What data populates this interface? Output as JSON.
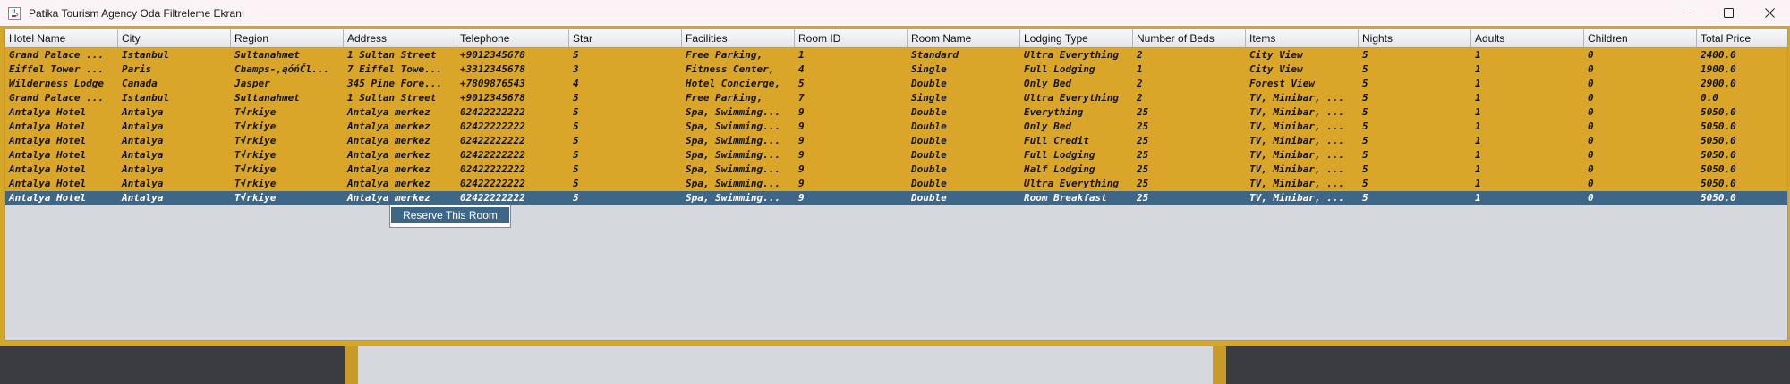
{
  "window": {
    "title": "Patika Tourism Agency Oda Filtreleme Ekranı",
    "icons": {
      "app": "java-cup-icon",
      "minimize": "minimize-icon",
      "maximize": "maximize-icon",
      "close": "close-icon"
    }
  },
  "table": {
    "columns": [
      "Hotel Name",
      "City",
      "Region",
      "Address",
      "Telephone",
      "Star",
      "Facilities",
      "Room ID",
      "Room Name",
      "Lodging Type",
      "Number of Beds",
      "Items",
      "Nights",
      "Adults",
      "Children",
      "Total Price"
    ],
    "rows": [
      [
        "Grand Palace ...",
        "Istanbul",
        "Sultanahmet",
        "1 Sultan Street",
        "+9012345678",
        "5",
        "Free Parking,",
        "1",
        "Standard",
        "Ultra Everything",
        "2",
        "City View",
        "5",
        "1",
        "0",
        "2400.0"
      ],
      [
        "Eiffel Tower ...",
        "Paris",
        "Champs-,ąóńČl...",
        "7 Eiffel Towe...",
        "+3312345678",
        "3",
        "Fitness Center,",
        "4",
        "Single",
        "Full Lodging",
        "1",
        "City View",
        "5",
        "1",
        "0",
        "1900.0"
      ],
      [
        "Wilderness Lodge",
        "Canada",
        "Jasper",
        "345 Pine Fore...",
        "+7809876543",
        "4",
        "Hotel Concierge,",
        "5",
        "Double",
        "Only Bed",
        "2",
        "Forest View",
        "5",
        "1",
        "0",
        "2900.0"
      ],
      [
        "Grand Palace ...",
        "Istanbul",
        "Sultanahmet",
        "1 Sultan Street",
        "+9012345678",
        "5",
        "Free Parking,",
        "7",
        "Single",
        "Ultra Everything",
        "2",
        "TV, Minibar, ...",
        "5",
        "1",
        "0",
        "0.0"
      ],
      [
        "Antalya Hotel",
        "Antalya",
        "T√rkiye",
        "Antalya merkez",
        "02422222222",
        "5",
        "Spa, Swimming...",
        "9",
        "Double",
        "Everything",
        "25",
        "TV, Minibar, ...",
        "5",
        "1",
        "0",
        "5050.0"
      ],
      [
        "Antalya Hotel",
        "Antalya",
        "T√rkiye",
        "Antalya merkez",
        "02422222222",
        "5",
        "Spa, Swimming...",
        "9",
        "Double",
        "Only Bed",
        "25",
        "TV, Minibar, ...",
        "5",
        "1",
        "0",
        "5050.0"
      ],
      [
        "Antalya Hotel",
        "Antalya",
        "T√rkiye",
        "Antalya merkez",
        "02422222222",
        "5",
        "Spa, Swimming...",
        "9",
        "Double",
        "Full Credit",
        "25",
        "TV, Minibar, ...",
        "5",
        "1",
        "0",
        "5050.0"
      ],
      [
        "Antalya Hotel",
        "Antalya",
        "T√rkiye",
        "Antalya merkez",
        "02422222222",
        "5",
        "Spa, Swimming...",
        "9",
        "Double",
        "Full Lodging",
        "25",
        "TV, Minibar, ...",
        "5",
        "1",
        "0",
        "5050.0"
      ],
      [
        "Antalya Hotel",
        "Antalya",
        "T√rkiye",
        "Antalya merkez",
        "02422222222",
        "5",
        "Spa, Swimming...",
        "9",
        "Double",
        "Half Lodging",
        "25",
        "TV, Minibar, ...",
        "5",
        "1",
        "0",
        "5050.0"
      ],
      [
        "Antalya Hotel",
        "Antalya",
        "T√rkiye",
        "Antalya merkez",
        "02422222222",
        "5",
        "Spa, Swimming...",
        "9",
        "Double",
        "Ultra Everything",
        "25",
        "TV, Minibar, ...",
        "5",
        "1",
        "0",
        "5050.0"
      ],
      [
        "Antalya Hotel",
        "Antalya",
        "T√rkiye",
        "Antalya merkez",
        "02422222222",
        "5",
        "Spa, Swimming...",
        "9",
        "Double",
        "Room Breakfast",
        "25",
        "TV, Minibar, ...",
        "5",
        "1",
        "0",
        "5050.0"
      ]
    ],
    "selected_row": 10
  },
  "context_menu": {
    "item_label": "Reserve This Room"
  },
  "colors": {
    "row_background": "#daa62a",
    "selected_row": "#3e6787",
    "frame": "#d4a72c",
    "table_background": "#d5d8dc"
  }
}
